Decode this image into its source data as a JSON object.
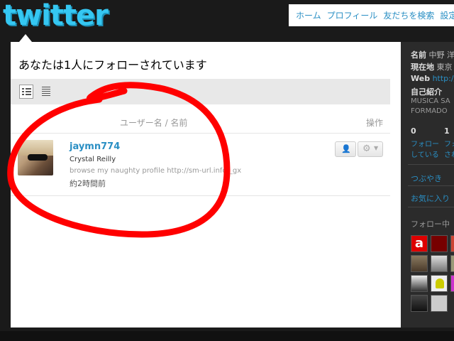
{
  "header": {
    "logo_text": "twitter",
    "nav": [
      "ホーム",
      "プロフィール",
      "友だちを検索",
      "設定"
    ]
  },
  "main": {
    "heading": "あなたは1人にフォローされています",
    "toolbar": {
      "views": [
        "list-view-icon",
        "compact-view-icon"
      ],
      "active": "list-view-icon"
    },
    "columns": {
      "name": "ユーザー名 / 名前",
      "action": "操作"
    },
    "followers": [
      {
        "screen_name": "jaymn774",
        "full_name": "Crystal Reilly",
        "bio": "browse my naughty profile http://sm-url.info/_gx",
        "time": "約2時間前",
        "avatar": "avatar-photo"
      }
    ],
    "annotation": {
      "shape": "hand-drawn-circle",
      "color": "#ff0000"
    }
  },
  "sidebar": {
    "name_label": "名前",
    "name_value": "中野 洋",
    "location_label": "現在地",
    "location_value": "東京",
    "web_label": "Web",
    "web_value": "http://b",
    "bio_label": "自己紹介",
    "bio_value_1": "MUSICA SA",
    "bio_value_2": "FORMADO",
    "following_count": "0",
    "followers_count": "1",
    "following_label_1": "フォロー",
    "following_label_2": "している",
    "followers_label_1": "フォ",
    "followers_label_2": "され",
    "tweets_link": "つぶやき",
    "favorites_link": "お気に入り",
    "following_section": "フォロー中"
  },
  "colors": {
    "background": "#1a1a1a",
    "link": "#2a8fc4",
    "logo": "#35c7f2",
    "annotation": "#ff0000"
  }
}
